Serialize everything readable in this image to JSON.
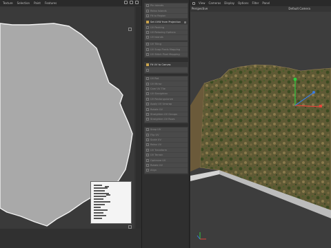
{
  "uv_editor": {
    "menu": [
      "Texture",
      "Selection",
      "Paint",
      "Features"
    ]
  },
  "commands": {
    "group1": [
      "Pin Islands",
      "Relax Islands",
      "Fit to Region"
    ],
    "group2_title": "Set UVW from Projection",
    "group2": [
      "UV Packing",
      "UV Relaxing Options",
      "UV Islands"
    ],
    "group3": [
      "UV Tiling",
      "UV Snap Pixels Mapping",
      "UV Stitch Pixel Mapping"
    ],
    "group4_title": "Fit UV to Canvas",
    "group5": [
      "UV Rot",
      "UV Mirror",
      "Cam UV Tile",
      "UV Straighten",
      "UV Rectangularize",
      "Apply UV Unwrap",
      "Rotate UV",
      "Straighten UV Groups",
      "Straighten UV Rows"
    ],
    "group6": [
      "Snap UV",
      "Flip UV",
      "Scale UV",
      "Relax UV",
      "UV Transform",
      "UV Terrain",
      "Optimize UV",
      "Rotate UV",
      "Align"
    ]
  },
  "viewport": {
    "menu": [
      "View",
      "Cameras",
      "Display",
      "Options",
      "Filter",
      "Panel"
    ],
    "view_name": "Perspective",
    "camera_name": "Default Camera"
  },
  "colors": {
    "uv_shape": "#a9a9a9",
    "uv_outline": "#f2f2f2",
    "terrain_base": "#5f5a35",
    "terrain_dark": "#3b4b22",
    "terrain_light": "#8a7a4c",
    "axis_y": "#2ecc40",
    "axis_x": "#e0453a",
    "axis_z": "#3a7be0",
    "accent": "#c9a34d"
  },
  "icons": [
    "grid-icon",
    "lock-icon",
    "expand-icon"
  ]
}
